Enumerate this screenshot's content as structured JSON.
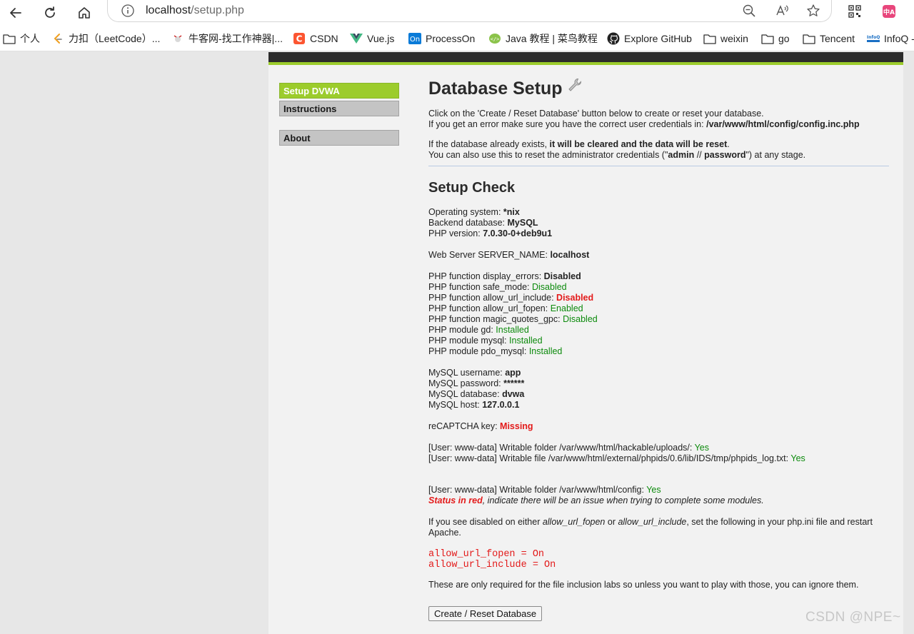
{
  "browser": {
    "url_host": "localhost",
    "url_path": "/setup.php",
    "bookmarks": [
      {
        "label": "个人",
        "icon": "folder-icon"
      },
      {
        "label": "力扣（LeetCode）...",
        "icon": "leetcode-icon"
      },
      {
        "label": "牛客网-找工作神器|...",
        "icon": "nowcoder-icon"
      },
      {
        "label": "CSDN",
        "icon": "csdn-icon"
      },
      {
        "label": "Vue.js",
        "icon": "vue-icon"
      },
      {
        "label": "ProcessOn",
        "icon": "processon-icon"
      },
      {
        "label": "Java 教程 | 菜鸟教程",
        "icon": "runoob-icon"
      },
      {
        "label": "Explore GitHub",
        "icon": "github-icon"
      },
      {
        "label": "weixin",
        "icon": "folder-icon"
      },
      {
        "label": "go",
        "icon": "folder-icon"
      },
      {
        "label": "Tencent",
        "icon": "folder-icon"
      },
      {
        "label": "InfoQ -",
        "icon": "infoq-icon"
      }
    ]
  },
  "sidebar": {
    "items": [
      {
        "label": "Setup DVWA",
        "active": true
      },
      {
        "label": "Instructions",
        "active": false
      },
      {
        "label": "About",
        "active": false
      }
    ]
  },
  "main": {
    "title": "Database Setup",
    "intro1": "Click on the 'Create / Reset Database' button below to create or reset your database.",
    "intro2_text": "If you get an error make sure you have the correct user credentials in: ",
    "intro2_path": "/var/www/html/config/config.inc.php",
    "exists_text": "If the database already exists, ",
    "exists_bold": "it will be cleared and the data will be reset",
    "exists_end": ".",
    "reset_text": "You can also use this to reset the administrator credentials (\"",
    "reset_admin": "admin",
    "reset_sep": " // ",
    "reset_password": "password",
    "reset_end": "\") at any stage.",
    "setup_check_title": "Setup Check",
    "os_label": "Operating system: ",
    "os_value": "*nix",
    "db_label": "Backend database: ",
    "db_value": "MySQL",
    "php_label": "PHP version: ",
    "php_value": "7.0.30-0+deb9u1",
    "server_label": "Web Server SERVER_NAME: ",
    "server_value": "localhost",
    "php_checks": [
      {
        "label": "PHP function display_errors: ",
        "value": "Disabled",
        "status": "plain"
      },
      {
        "label": "PHP function safe_mode: ",
        "value": "Disabled",
        "status": "ok"
      },
      {
        "label": "PHP function allow_url_include: ",
        "value": "Disabled",
        "status": "bad"
      },
      {
        "label": "PHP function allow_url_fopen: ",
        "value": "Enabled",
        "status": "ok"
      },
      {
        "label": "PHP function magic_quotes_gpc: ",
        "value": "Disabled",
        "status": "ok"
      },
      {
        "label": "PHP module gd: ",
        "value": "Installed",
        "status": "ok"
      },
      {
        "label": "PHP module mysql: ",
        "value": "Installed",
        "status": "ok"
      },
      {
        "label": "PHP module pdo_mysql: ",
        "value": "Installed",
        "status": "ok"
      }
    ],
    "mysql": [
      {
        "label": "MySQL username: ",
        "value": "app"
      },
      {
        "label": "MySQL password: ",
        "value": "******"
      },
      {
        "label": "MySQL database: ",
        "value": "dvwa"
      },
      {
        "label": "MySQL host: ",
        "value": "127.0.0.1"
      }
    ],
    "recaptcha_label": "reCAPTCHA key: ",
    "recaptcha_value": "Missing",
    "writable1_text": "[User: www-data] Writable folder /var/www/html/hackable/uploads/: ",
    "writable1_value": "Yes",
    "writable2_text": "[User: www-data] Writable file /var/www/html/external/phpids/0.6/lib/IDS/tmp/phpids_log.txt: ",
    "writable2_value": "Yes",
    "writable3_text": "[User: www-data] Writable folder /var/www/html/config: ",
    "writable3_value": "Yes",
    "status_red": "Status in red",
    "status_rest": ", indicate there will be an issue when trying to complete some modules.",
    "disabled_pre": "If you see disabled on either ",
    "disabled_fopen": "allow_url_fopen",
    "disabled_or": " or ",
    "disabled_include": "allow_url_include",
    "disabled_post": ", set the following in your php.ini file and restart Apache.",
    "code1": "allow_url_fopen = On",
    "code2": "allow_url_include = On",
    "labs_note": "These are only required for the file inclusion labs so unless you want to play with those, you can ignore them.",
    "create_button": "Create / Reset Database"
  },
  "watermark": "CSDN @NPE~"
}
